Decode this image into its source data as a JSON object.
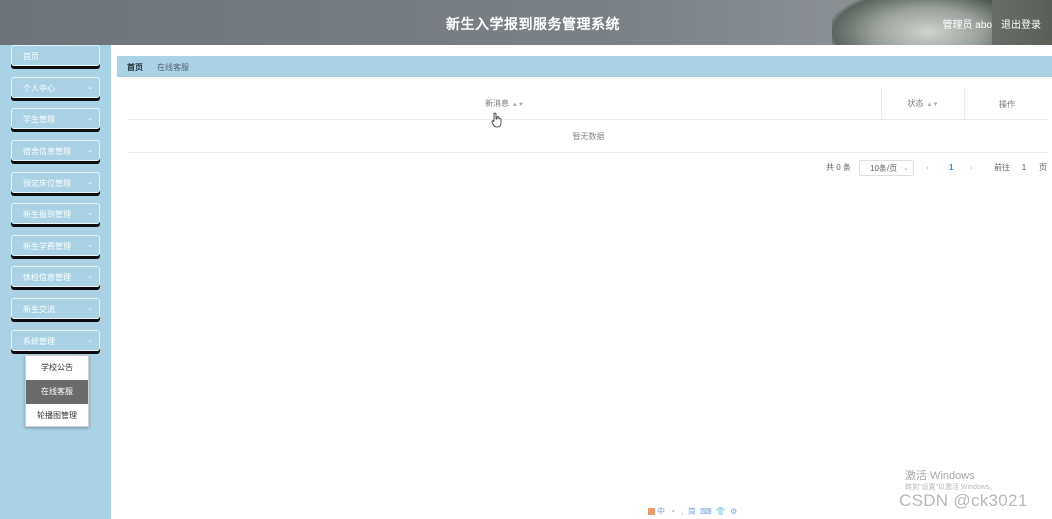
{
  "header": {
    "title": "新生入学报到服务管理系统",
    "user": "管理员 abo",
    "logout": "退出登录"
  },
  "sidebar": {
    "items": [
      {
        "label": "首页",
        "has_arrow": false
      },
      {
        "label": "个人中心",
        "has_arrow": true
      },
      {
        "label": "学生管理",
        "has_arrow": true
      },
      {
        "label": "宿舍信息管理",
        "has_arrow": true
      },
      {
        "label": "预定床位管理",
        "has_arrow": true
      },
      {
        "label": "新生报到管理",
        "has_arrow": true
      },
      {
        "label": "新生学费管理",
        "has_arrow": true
      },
      {
        "label": "体检信息管理",
        "has_arrow": true
      },
      {
        "label": "新生交流",
        "has_arrow": true
      },
      {
        "label": "系统管理",
        "has_arrow": true
      }
    ],
    "submenu": [
      {
        "label": "学校公告",
        "active": false
      },
      {
        "label": "在线客服",
        "active": true
      },
      {
        "label": "轮播图管理",
        "active": false
      }
    ]
  },
  "breadcrumb": {
    "home": "首页",
    "current": "在线客服"
  },
  "table": {
    "columns": [
      "新消息",
      "状态",
      "操作"
    ],
    "empty_text": "暂无数据"
  },
  "pagination": {
    "total": "共 0 条",
    "page_size": "10条/页",
    "prev": "‹",
    "current_page": "1",
    "next": "›",
    "goto_label": "前往",
    "goto_value": "1",
    "unit": "页"
  },
  "watermark": {
    "windows_title": "激活 Windows",
    "windows_hint": "转到\"设置\"以激活 Windows。",
    "csdn": "CSDN @ck3021",
    "ime": "中 ・ , 简 ⌨ 👕 ⚙"
  },
  "icons": {
    "chevron": "chevron-down-icon",
    "sort": "sort-caret-icon",
    "cursor": "hand-cursor-icon"
  }
}
